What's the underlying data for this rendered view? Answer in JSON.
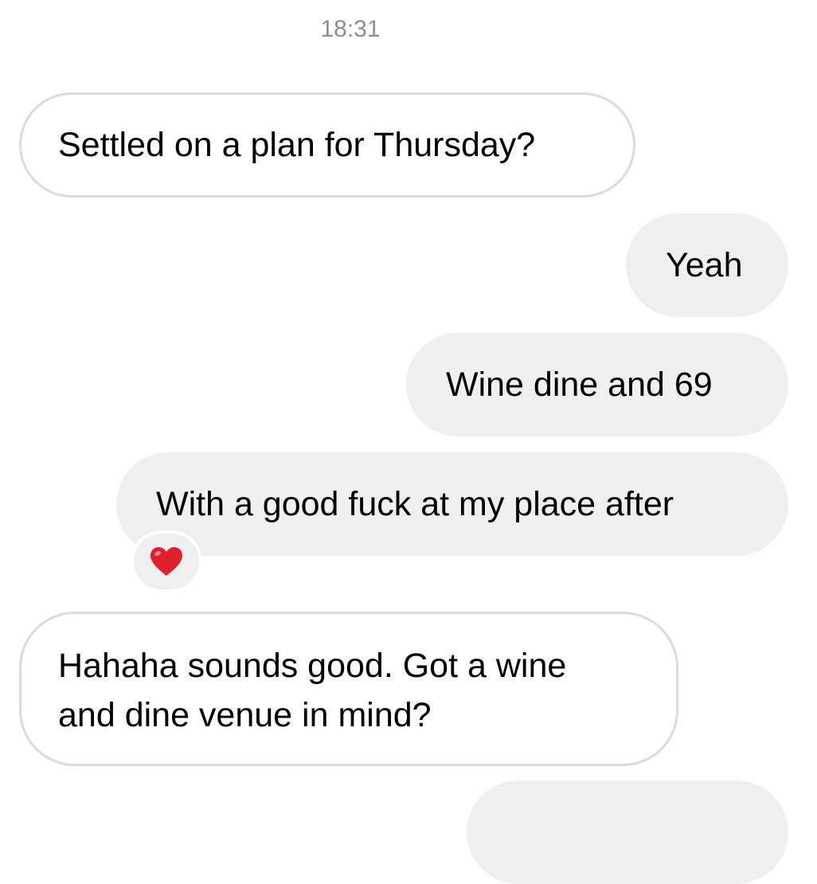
{
  "thread": {
    "timestamp": "18:31",
    "messages": [
      {
        "direction": "incoming",
        "lines": [
          "Settled on a plan for Thursday?"
        ]
      },
      {
        "direction": "outgoing",
        "lines": [
          "Yeah"
        ]
      },
      {
        "direction": "outgoing",
        "lines": [
          "Wine dine and 69"
        ]
      },
      {
        "direction": "outgoing",
        "lines": [
          "With a good fuck at my place after"
        ],
        "reaction": "❤️"
      },
      {
        "direction": "incoming",
        "lines": [
          "Hahaha sounds good. Got a wine",
          "and dine venue in mind?"
        ]
      },
      {
        "direction": "outgoing",
        "lines": []
      }
    ]
  },
  "colors": {
    "outgoing_bubble": "#efefef",
    "incoming_border": "#dbdbdb",
    "timestamp": "#8e8e8e",
    "reaction_heart": "#e0202d"
  }
}
